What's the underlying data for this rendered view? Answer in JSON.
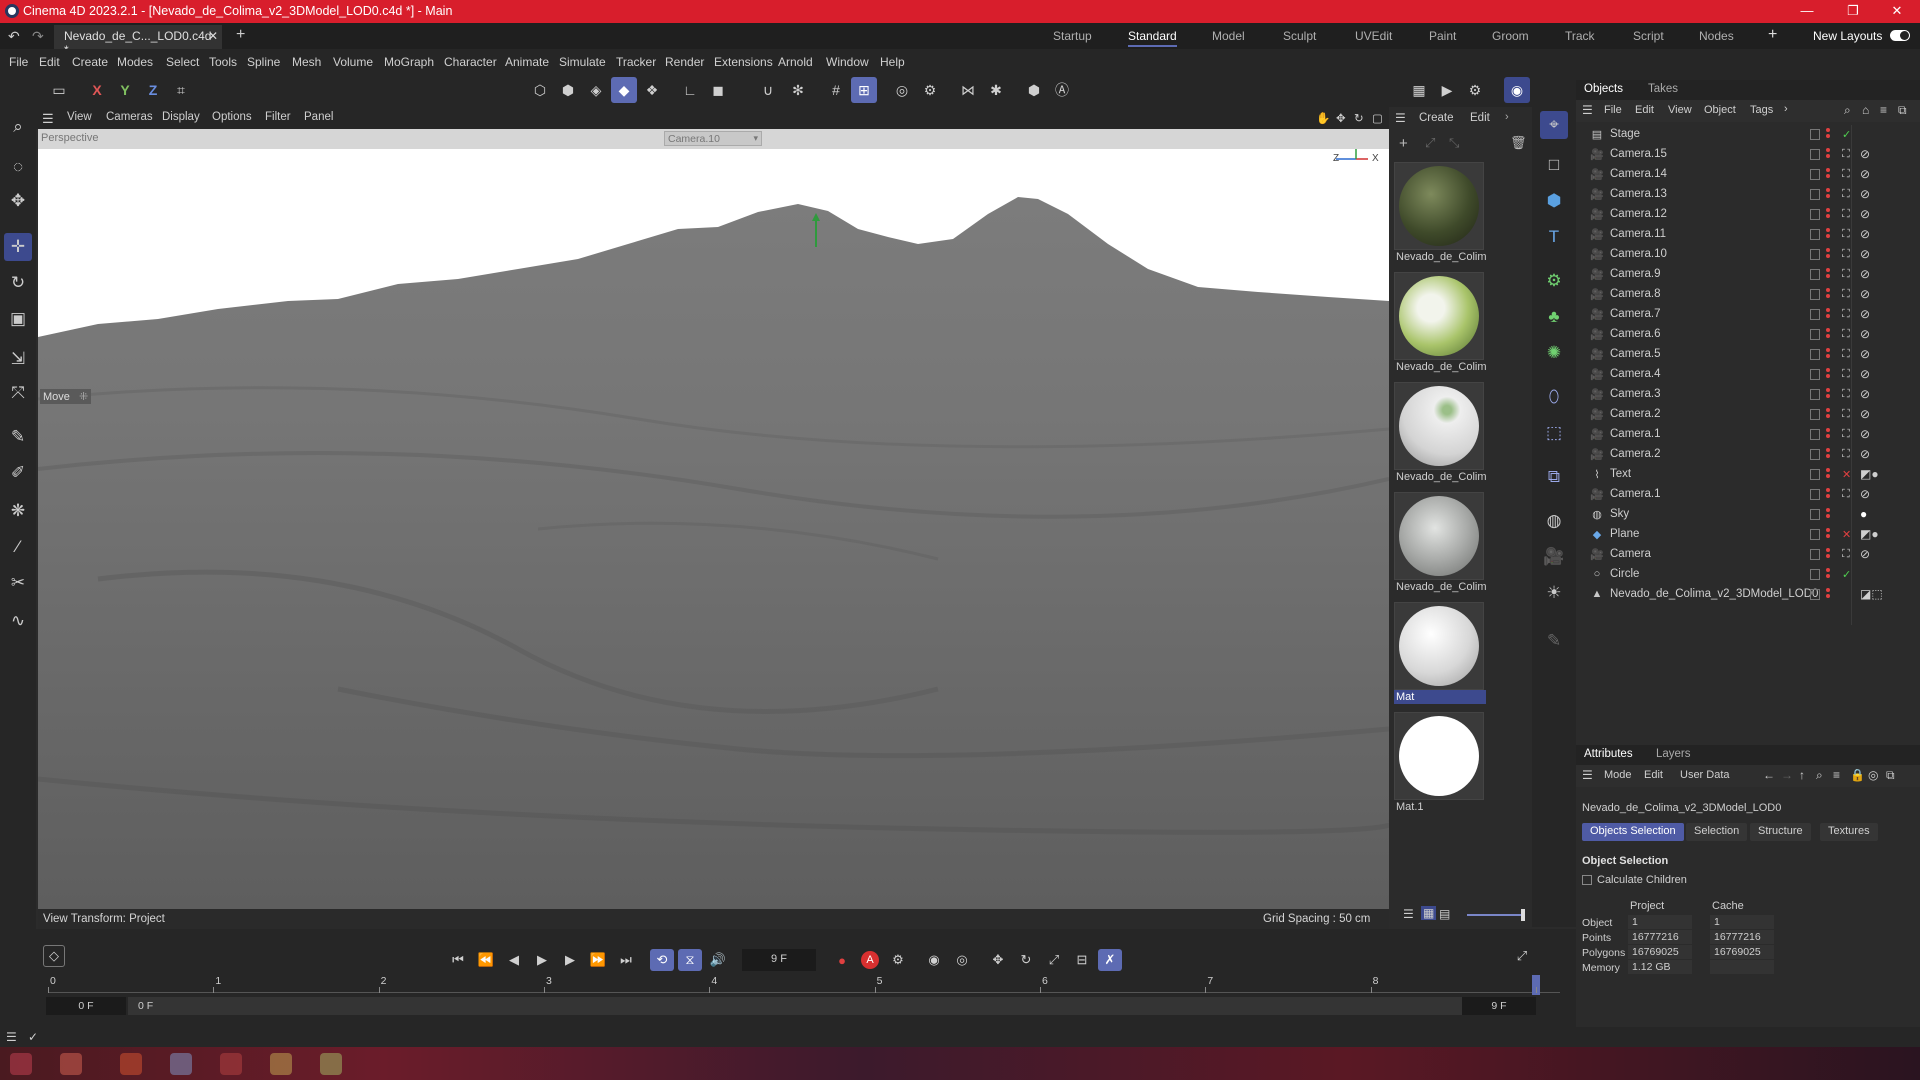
{
  "window": {
    "title": "Cinema 4D 2023.2.1 - [Nevado_de_Colima_v2_3DModel_LOD0.c4d *] - Main",
    "minimize": "—",
    "maximize": "❐",
    "close": "✕"
  },
  "tabbar": {
    "document_tab": "Nevado_de_C..._LOD0.c4d *",
    "close_glyph": "✕",
    "add_glyph": "+",
    "layouts": [
      "Startup",
      "Standard",
      "Model",
      "Sculpt",
      "UVEdit",
      "Paint",
      "Groom",
      "Track",
      "Script",
      "Nodes"
    ],
    "active_layout": "Standard",
    "add_layout": "+",
    "new_layouts": "New Layouts"
  },
  "menubar": [
    "File",
    "Edit",
    "Create",
    "Modes",
    "Select",
    "Tools",
    "Spline",
    "Mesh",
    "Volume",
    "MoGraph",
    "Character",
    "Animate",
    "Simulate",
    "Tracker",
    "Render",
    "Extensions",
    "Arnold",
    "Window",
    "Help"
  ],
  "toolbar": {
    "axis_x": "X",
    "axis_y": "Y",
    "axis_z": "Z"
  },
  "viewport": {
    "menu": [
      "View",
      "Cameras",
      "Display",
      "Options",
      "Filter",
      "Panel"
    ],
    "label": "Perspective",
    "camera": "Camera.10",
    "tool_hint": "Move",
    "view_transform": "View Transform: Project",
    "grid_spacing": "Grid Spacing : 50 cm",
    "axis_x": "X",
    "axis_z": "Z"
  },
  "materials": {
    "menu": [
      "Create",
      "Edit"
    ],
    "items": [
      {
        "name": "Nevado_de_Colim",
        "style": "rock-green"
      },
      {
        "name": "Nevado_de_Colim",
        "style": "green-white"
      },
      {
        "name": "Nevado_de_Colim",
        "style": "white-green"
      },
      {
        "name": "Nevado_de_Colim",
        "style": "grey-cracked"
      },
      {
        "name": "Mat",
        "style": "white"
      },
      {
        "name": "Mat.1",
        "style": "pure-white"
      }
    ]
  },
  "objects_panel": {
    "tabs": [
      "Objects",
      "Takes"
    ],
    "menu": [
      "File",
      "Edit",
      "View",
      "Object",
      "Tags"
    ],
    "more": "›",
    "rows": [
      {
        "name": "Stage",
        "icon": "stage",
        "tag": "check"
      },
      {
        "name": "Camera.15",
        "icon": "camera",
        "tag": "target"
      },
      {
        "name": "Camera.14",
        "icon": "camera",
        "tag": "target"
      },
      {
        "name": "Camera.13",
        "icon": "camera",
        "tag": "target"
      },
      {
        "name": "Camera.12",
        "icon": "camera",
        "tag": "target"
      },
      {
        "name": "Camera.11",
        "icon": "camera",
        "tag": "target"
      },
      {
        "name": "Camera.10",
        "icon": "camera",
        "tag": "target"
      },
      {
        "name": "Camera.9",
        "icon": "camera",
        "tag": "target"
      },
      {
        "name": "Camera.8",
        "icon": "camera",
        "tag": "target"
      },
      {
        "name": "Camera.7",
        "icon": "camera",
        "tag": "target"
      },
      {
        "name": "Camera.6",
        "icon": "camera",
        "tag": "target"
      },
      {
        "name": "Camera.5",
        "icon": "camera",
        "tag": "target"
      },
      {
        "name": "Camera.4",
        "icon": "camera",
        "tag": "target"
      },
      {
        "name": "Camera.3",
        "icon": "camera",
        "tag": "target"
      },
      {
        "name": "Camera.2",
        "icon": "camera",
        "tag": "target"
      },
      {
        "name": "Camera.1",
        "icon": "camera",
        "tag": "target"
      },
      {
        "name": "Camera.2",
        "icon": "camera",
        "tag": "target"
      },
      {
        "name": "Text",
        "icon": "text",
        "tag": "x"
      },
      {
        "name": "Camera.1",
        "icon": "camera",
        "tag": "target"
      },
      {
        "name": "Sky",
        "icon": "sky",
        "tag": "none"
      },
      {
        "name": "Plane",
        "icon": "plane",
        "tag": "x"
      },
      {
        "name": "Camera",
        "icon": "camera",
        "tag": "target"
      },
      {
        "name": "Circle",
        "icon": "circle",
        "tag": "check"
      },
      {
        "name": "Nevado_de_Colima_v2_3DModel_LOD0",
        "icon": "polygon",
        "tag": "none"
      }
    ]
  },
  "attributes": {
    "tabs": [
      "Attributes",
      "Layers"
    ],
    "menu": [
      "Mode",
      "Edit",
      "User Data"
    ],
    "object_name": "Nevado_de_Colima_v2_3DModel_LOD0",
    "subtabs": [
      "Objects Selection",
      "Selection",
      "Structure",
      "Textures"
    ],
    "active_subtab": "Objects Selection",
    "section": "Object Selection",
    "calculate_children": "Calculate Children",
    "col_project": "Project",
    "col_cache": "Cache",
    "rows": [
      {
        "label": "Object",
        "project": "1",
        "cache": "1"
      },
      {
        "label": "Points",
        "project": "16777216",
        "cache": "16777216"
      },
      {
        "label": "Polygons",
        "project": "16769025",
        "cache": "16769025"
      },
      {
        "label": "Memory",
        "project": "1.12 GB",
        "cache": ""
      }
    ]
  },
  "timeline": {
    "current_frame": "9 F",
    "start_frame": "0 F",
    "range_start": "0 F",
    "range_end": "9 F",
    "end_frame": "9 F",
    "ruler": [
      "0",
      "1",
      "2",
      "3",
      "4",
      "5",
      "6",
      "7",
      "8",
      "9"
    ],
    "record_label": "A"
  },
  "colors": {
    "accent": "#5d6bb3",
    "titlebar": "#d81e2c",
    "panel": "#2b2b2b"
  }
}
